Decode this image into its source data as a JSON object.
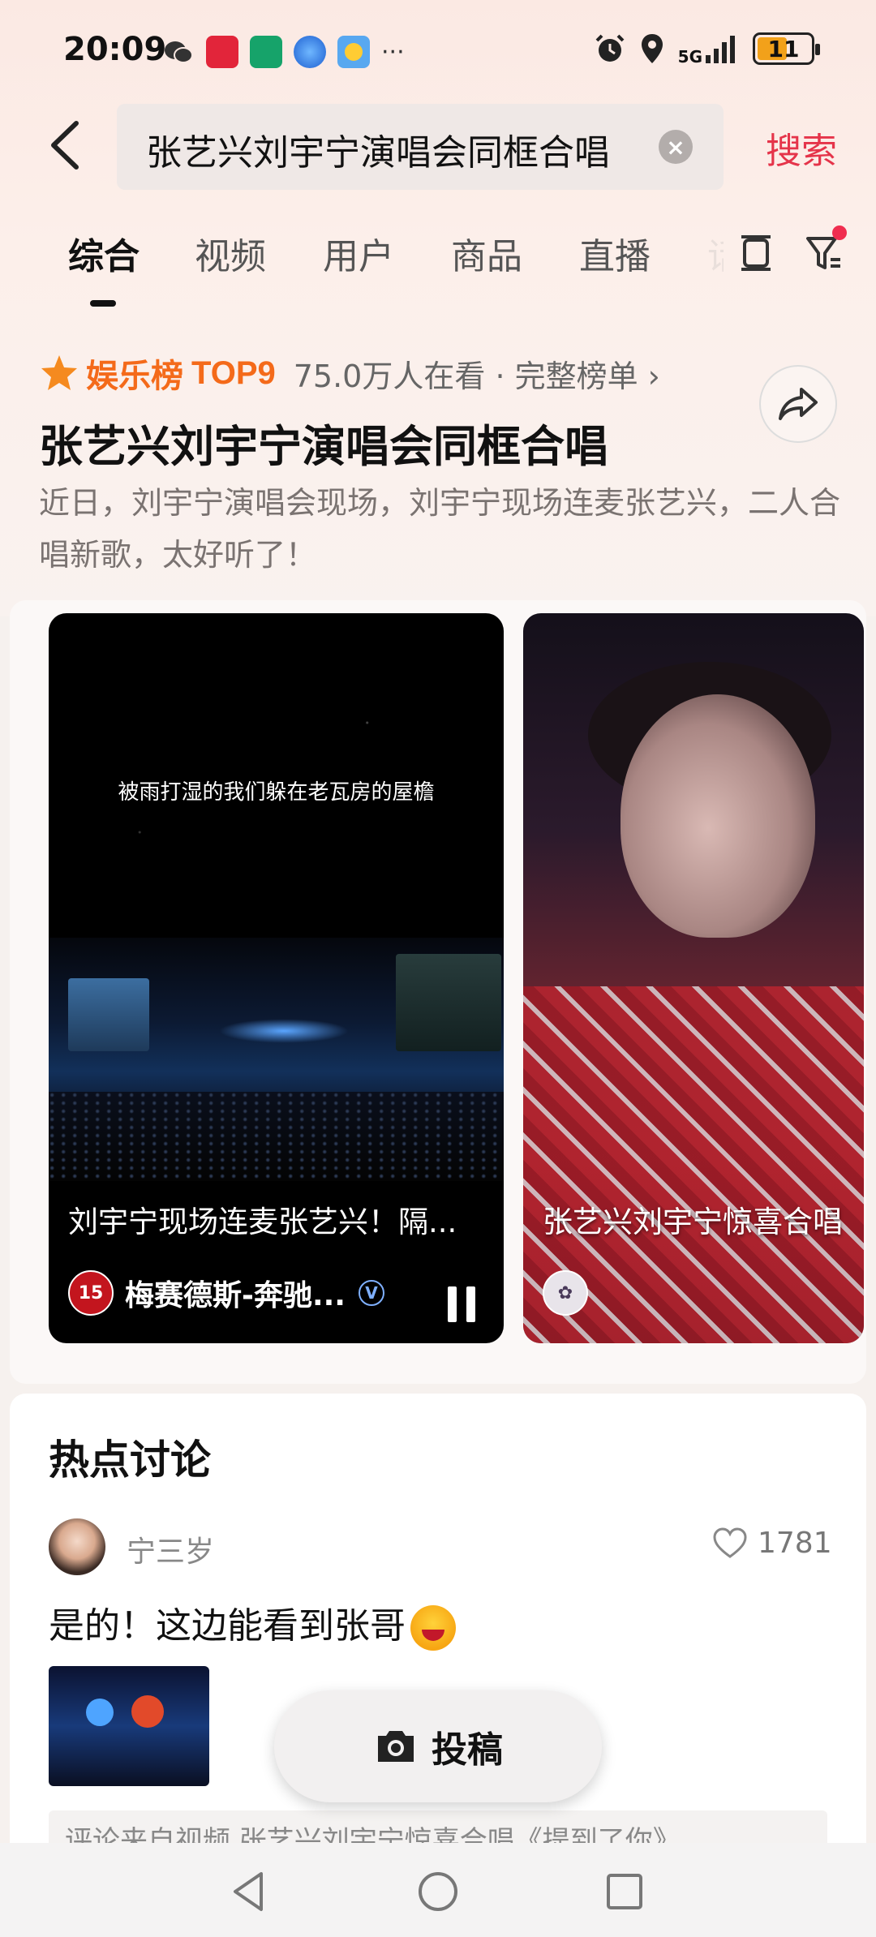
{
  "status_bar": {
    "time": "20:09",
    "battery_level": "11",
    "network": "5G",
    "app_icons": [
      "wechat-icon",
      "taobao-icon",
      "green-app-icon",
      "browser-icon",
      "weather-icon"
    ],
    "more": "···"
  },
  "search": {
    "query": "张艺兴刘宇宁演唱会同框合唱",
    "button_label": "搜索"
  },
  "tabs": {
    "items": [
      "综合",
      "视频",
      "用户",
      "商品",
      "直播"
    ],
    "partial": "话",
    "active_index": 0
  },
  "ranking": {
    "label": "娱乐榜",
    "rank": "TOP9",
    "meta": "75.0万人在看 · 完整榜单 ›",
    "headline": "张艺兴刘宇宁演唱会同框合唱",
    "description": "近日，刘宇宁演唱会现场，刘宇宁现场连麦张艺兴，二人合唱新歌，太好听了！"
  },
  "videos": [
    {
      "lyric": "被雨打湿的我们躲在老瓦房的屋檐",
      "title": "刘宇宁现场连麦张艺兴！隔...",
      "author": "梅赛德斯-奔驰...",
      "avatar_text": "15",
      "verified": "V"
    },
    {
      "title": "张艺兴刘宇宁惊喜合唱",
      "author": ""
    }
  ],
  "discussion": {
    "title": "热点讨论",
    "comment": {
      "user": "宁三岁",
      "likes": "1781",
      "text": "是的！这边能看到张哥",
      "source": "评论来自视频 张艺兴刘宇宁惊喜合唱《提到了你》"
    }
  },
  "submit": {
    "label": "投稿"
  },
  "colors": {
    "accent": "#e5344a",
    "rank_orange": "#f46a1a"
  }
}
